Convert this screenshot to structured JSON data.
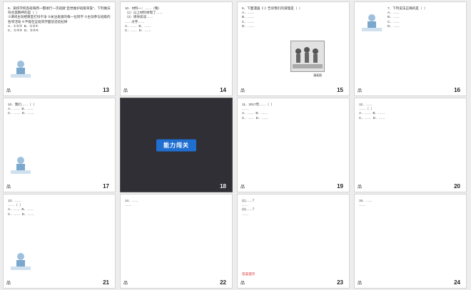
{
  "slides": [
    {
      "num": "13",
      "foot": "品",
      "text": "9．某校学校各班每周一都进行一次班级\"自觉维护班级荣誉\"，下列做法符合其精神的是（  ）\n①课间主动把教室打扫干净 ②关注班级的每一位同学 ③主动参与班级的各项活动 ④不能在全班同学面前违反纪律\nA．①②③  B．①②④\nC．①③④  D．②③④"
    },
    {
      "num": "14",
      "foot": "品",
      "text": "10．材料一：……（略）\n（1）以上材料体现了……\n（2）请你谈谈……\n……文字……\nA．……  B．……\nC．……  D．……"
    },
    {
      "num": "15",
      "foot": "品",
      "text": "5．下面漫画《 》告诉我们的道理是（  ）\nA．……\nB．……\nC．……\nD．……",
      "cartoon_caption": "漫画图"
    },
    {
      "num": "16",
      "foot": "品",
      "text": "7．下列说法正确的是（  ）\nA．……\nB．……\nC．……\nD．……"
    },
    {
      "num": "17",
      "foot": "品",
      "text": "10．我们……（  ）\nA．……  B．……\nC．……  D．……"
    },
    {
      "num": "18",
      "foot": "品",
      "banner": "能力闯关"
    },
    {
      "num": "19",
      "foot": "品",
      "text": "11．2017年……（  ）\n……\nA．……  B．……\nC．……  D．……"
    },
    {
      "num": "20",
      "foot": "品",
      "text": "12．……\n……（  ）\nA．……  B．……\nC．……  D．……"
    },
    {
      "num": "21",
      "foot": "品",
      "text": "13．……\n……（  ）\nA．……  B．……\nC．……  D．……"
    },
    {
      "num": "22",
      "foot": "品",
      "text": "14．……\n……"
    },
    {
      "num": "23",
      "foot": "品",
      "text": "(1)……？\n……\n(2)……？\n……",
      "answer_note": "答案提示"
    },
    {
      "num": "24",
      "foot": "品",
      "text": "15．……\n……"
    }
  ],
  "colors": {
    "accent": "#1f6fd1",
    "answer": "#d22222"
  }
}
